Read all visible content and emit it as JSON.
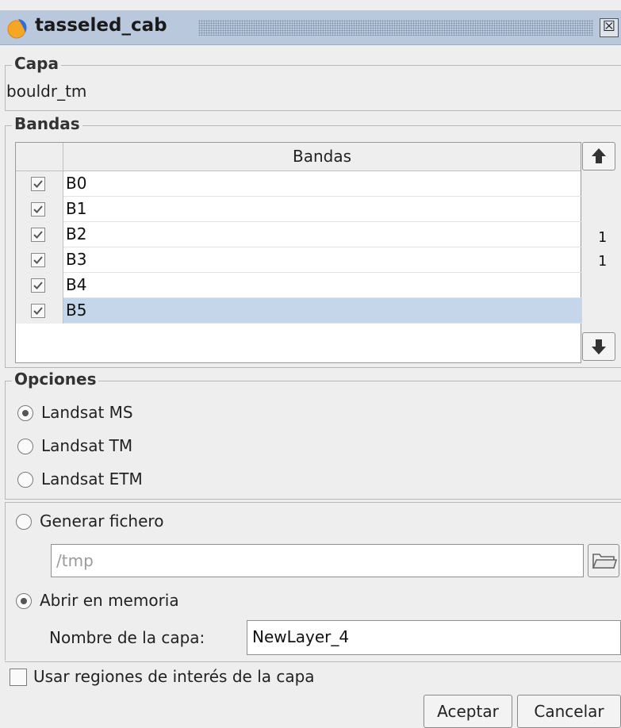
{
  "window": {
    "title": "tasseled_cab",
    "close_symbol": "☒"
  },
  "capa": {
    "legend": "Capa",
    "value": "bouldr_tm"
  },
  "bandas": {
    "legend": "Bandas",
    "column_header": "Bandas",
    "rows": [
      {
        "label": "B0",
        "checked": true
      },
      {
        "label": "B1",
        "checked": true
      },
      {
        "label": "B2",
        "checked": true
      },
      {
        "label": "B3",
        "checked": true
      },
      {
        "label": "B4",
        "checked": true
      },
      {
        "label": "B5",
        "checked": true,
        "selected": true
      }
    ],
    "side_values": [
      "1",
      "1"
    ]
  },
  "opciones": {
    "legend": "Opciones",
    "options": [
      {
        "label": "Landsat MS",
        "selected": true
      },
      {
        "label": "Landsat TM",
        "selected": false
      },
      {
        "label": "Landsat ETM",
        "selected": false
      }
    ]
  },
  "output": {
    "generate_file_label": "Generar fichero",
    "generate_file_selected": false,
    "path_value": "/tmp",
    "open_in_memory_label": "Abrir en memoria",
    "open_in_memory_selected": true,
    "layer_name_label": "Nombre de la capa:",
    "layer_name_value": "NewLayer_4"
  },
  "roi": {
    "label": "Usar regiones de interés de la capa",
    "checked": false
  },
  "buttons": {
    "accept": "Aceptar",
    "cancel": "Cancelar"
  }
}
